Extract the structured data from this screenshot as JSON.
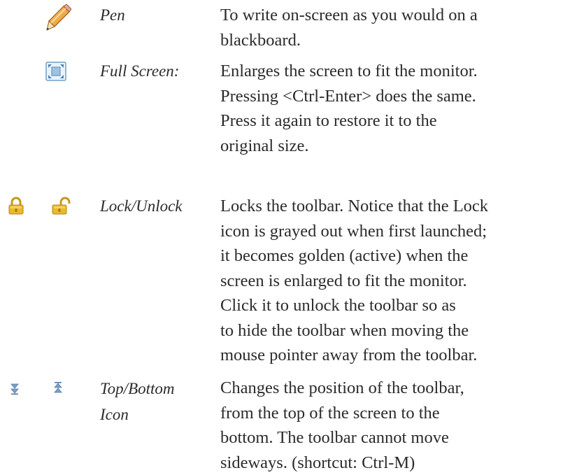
{
  "entries": [
    {
      "term": "Pen",
      "description": "To write on-screen as you would on a\nblackboard.",
      "icons": [
        "pencil-icon"
      ]
    },
    {
      "term": "Full Screen:",
      "description": "Enlarges the screen to fit the monitor.\nPressing <Ctrl-Enter> does the same.\nPress it again to restore it to the\noriginal size.",
      "icons": [
        "full-screen-icon"
      ]
    },
    {
      "term": "Lock/Unlock",
      "description": "Locks the toolbar. Notice that the Lock\nicon is grayed out when first launched;\nit becomes golden (active) when the\nscreen is enlarged to fit the monitor.\nClick it to unlock the toolbar so as\nto hide the toolbar when moving the\nmouse pointer away from the toolbar.",
      "icons": [
        "lock-icon",
        "unlock-icon"
      ]
    },
    {
      "term": "Top/Bottom\nIcon",
      "description": "Changes the position of the toolbar,\nfrom the top of the screen to the\nbottom. The toolbar cannot move\nsideways. (shortcut: Ctrl-M)",
      "icons": [
        "move-to-bottom-icon",
        "move-to-top-icon"
      ]
    }
  ],
  "colors": {
    "text": "#2b2b2b",
    "lock_gold": "#e1b21c",
    "pencil_orange": "#f2a23a",
    "fullscreen_blue": "#6f9fc7",
    "arrow_blue": "#6a8fb5"
  }
}
